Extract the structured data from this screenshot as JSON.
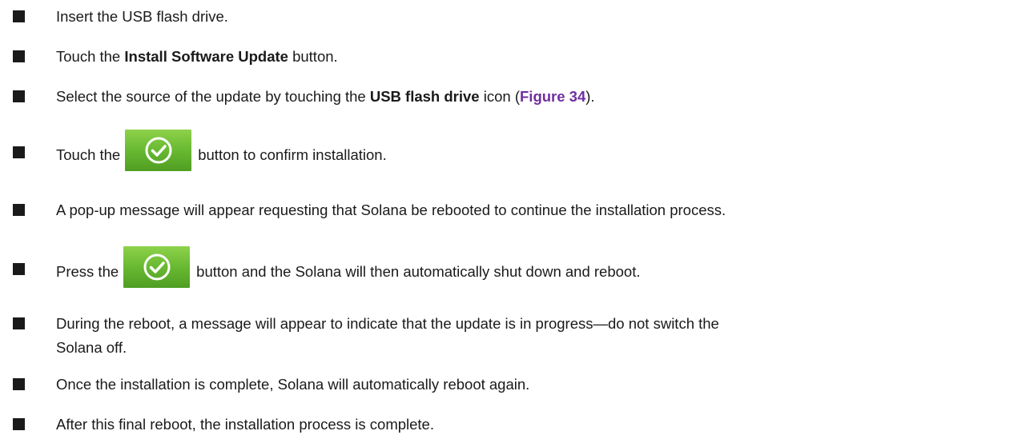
{
  "instructions": {
    "step1": {
      "text": "Insert the USB flash drive."
    },
    "step2": {
      "pre": "Touch the ",
      "bold": "Install Software Update",
      "post": " button."
    },
    "step3": {
      "pre": "Select the source of the update by touching the ",
      "bold": "USB flash drive",
      "mid": " icon (",
      "link": "Figure 34",
      "post": ")."
    },
    "step4": {
      "pre": "Touch the",
      "post": "button to confirm installation."
    },
    "step5": {
      "text": "A pop-up message will appear requesting that Solana be rebooted to continue the installation process."
    },
    "step6": {
      "pre": "Press the",
      "post": "button  and the Solana will then automatically shut down and reboot."
    },
    "step7": {
      "line1": "During the reboot, a message will appear to indicate that the update is in progress—do not switch the",
      "line2": "Solana off."
    },
    "step8": {
      "text": "Once the installation is complete, Solana will automatically reboot again."
    },
    "step9": {
      "text": "After this final reboot, the installation process is complete."
    }
  },
  "colors": {
    "link": "#7030a0",
    "confirm_button": "#6cbb34",
    "bullet": "#1a1a1a"
  },
  "icons": {
    "bullet": "square-bullet-icon",
    "confirm": "check-circle-icon"
  }
}
